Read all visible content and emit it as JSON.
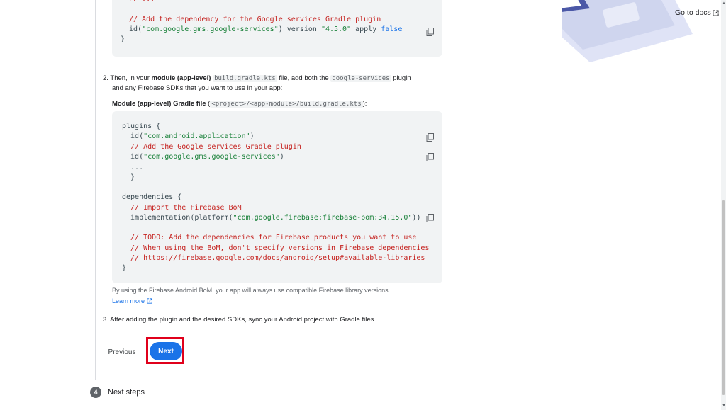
{
  "header": {
    "go_to_docs": "Go to docs"
  },
  "top_code": {
    "line1": "// ...",
    "line2": "// Add the dependency for the Google services Gradle plugin",
    "line3_pre": "id(",
    "line3_str": "\"com.google.gms.google-services\"",
    "line3_mid": ") version ",
    "line3_ver": "\"4.5.0\"",
    "line3_apply": " apply ",
    "line3_false": "false",
    "line4": "}"
  },
  "step2": {
    "number": "2.",
    "text_a": "Then, in your ",
    "text_bold": "module (app-level)",
    "text_code": "build.gradle.kts",
    "text_b": " file, add both the ",
    "text_code2": "google-services",
    "text_c": " plugin",
    "line2": "and any Firebase SDKs that you want to use in your app:",
    "file_label_bold": "Module (app-level) Gradle file",
    "file_label_path": "<project>/<app-module>/build.gradle.kts",
    "file_label_open": " (",
    "file_label_close": "):"
  },
  "main_code": {
    "l1": "plugins {",
    "l2_pre": "  id(",
    "l2_str": "\"com.android.application\"",
    "l2_post": ")",
    "l3": "  // Add the Google services Gradle plugin",
    "l4_pre": "  id(",
    "l4_str": "\"com.google.gms.google-services\"",
    "l4_post": ")",
    "l5": "  ...",
    "l6": "}",
    "l7": "dependencies {",
    "l8": "  // Import the Firebase BoM",
    "l9_pre": "  implementation(platform(",
    "l9_str": "\"com.google.firebase:firebase-bom:34.15.0\"",
    "l9_post": "))",
    "l10": "  // TODO: Add the dependencies for Firebase products you want to use",
    "l11": "  // When using the BoM, don't specify versions in Firebase dependencies",
    "l12": "  // https://firebase.google.com/docs/android/setup#available-libraries",
    "l13": "}"
  },
  "bom_note": {
    "text": "By using the Firebase Android BoM, your app will always use compatible Firebase library versions.",
    "learn_more": "Learn more"
  },
  "step3": {
    "number": "3.",
    "text": "After adding the plugin and the desired SDKs, sync your Android project with Gradle files."
  },
  "nav": {
    "previous": "Previous",
    "next": "Next"
  },
  "next_steps": {
    "number": "4",
    "label": "Next steps"
  },
  "colors": {
    "primary": "#1a73e8",
    "highlight": "#e0001b",
    "comment": "#c5221f",
    "string": "#188038"
  },
  "icons": [
    "copy-icon",
    "external-link-icon"
  ]
}
